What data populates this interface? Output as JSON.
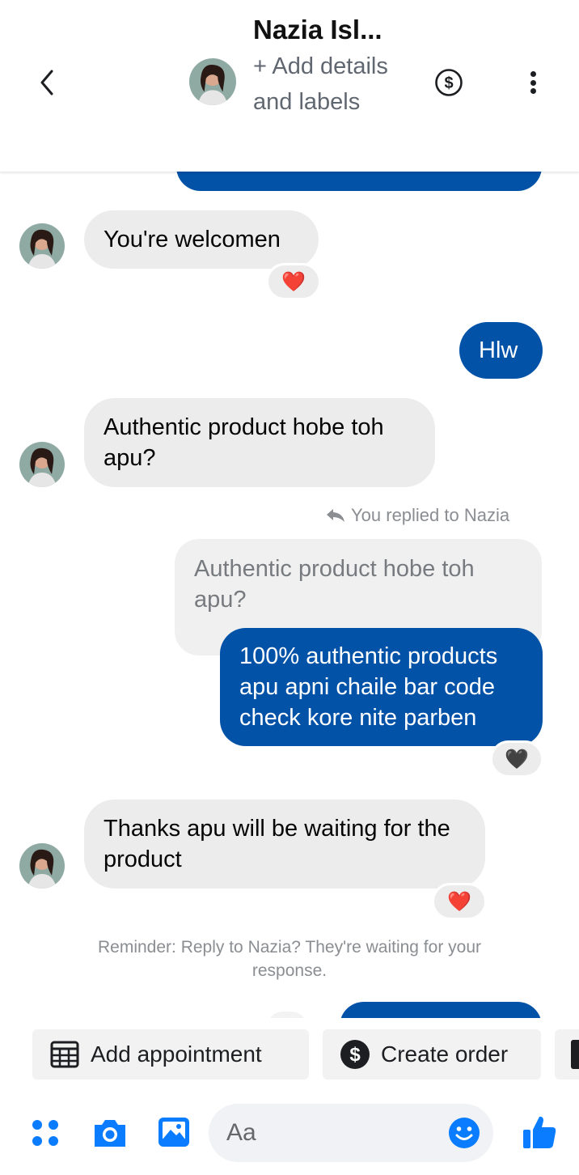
{
  "header": {
    "contact_name": "Nazia Isl...",
    "subtitle": "+ Add details and labels",
    "back_icon": "chevron-left-icon",
    "payment_icon": "dollar-circle-icon",
    "menu_icon": "more-vertical-icon"
  },
  "messages": {
    "m1": "You're welcomen",
    "m1_reaction": "❤️",
    "m2": "Hlw",
    "m3": "Authentic product hobe toh apu?",
    "reply_note": "You replied to Nazia",
    "quoted": "Authentic product hobe toh apu?",
    "m4": "100% authentic products apu apni chaile bar code check kore nite parben",
    "m4_reaction": "🖤",
    "m5": "Thanks apu will be waiting for the product",
    "m5_reaction": "❤️"
  },
  "reminder": "Reminder: Reply to Nazia? They're waiting for your response.",
  "quick_actions": {
    "add_appointment": "Add appointment",
    "create_order": "Create order"
  },
  "composer": {
    "placeholder": "Aa"
  },
  "colors": {
    "outgoing_bubble": "#0252a8",
    "incoming_bubble": "#ececec",
    "accent": "#0a7cff",
    "reaction_red": "#e41e3f"
  }
}
